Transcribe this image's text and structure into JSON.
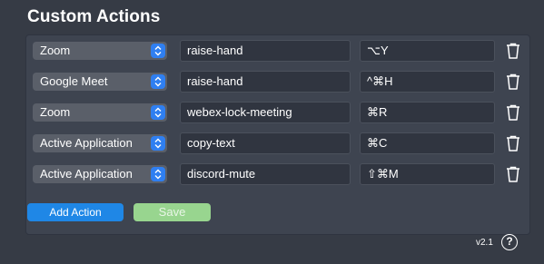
{
  "window": {
    "title": "Custom Actions"
  },
  "actions": [
    {
      "app": "Zoom",
      "action": "raise-hand",
      "shortcut": "⌥Y"
    },
    {
      "app": "Google Meet",
      "action": "raise-hand",
      "shortcut": "^⌘H"
    },
    {
      "app": "Zoom",
      "action": "webex-lock-meeting",
      "shortcut": "⌘R"
    },
    {
      "app": "Active Application",
      "action": "copy-text",
      "shortcut": "⌘C"
    },
    {
      "app": "Active Application",
      "action": "discord-mute",
      "shortcut": "⇧⌘M"
    }
  ],
  "buttons": {
    "add_label": "Add Action",
    "save_label": "Save"
  },
  "footer": {
    "version": "v2.1",
    "help_label": "?"
  },
  "icons": {
    "select": "chevron-up-down-icon",
    "delete": "trash-icon",
    "help": "question-mark-icon"
  },
  "colors": {
    "accent": "#2f7ff1",
    "add_button": "#1f87e6",
    "save_button": "#98d58f",
    "background": "#363b45"
  }
}
